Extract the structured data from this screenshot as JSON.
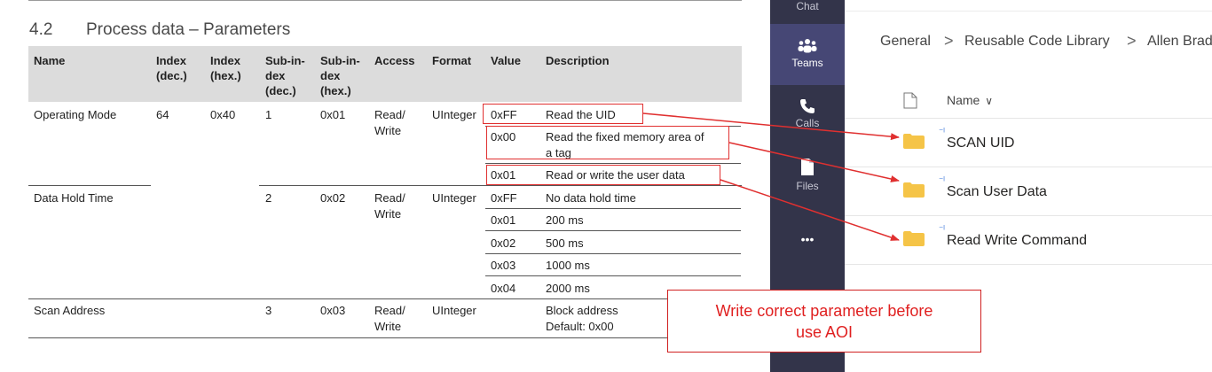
{
  "document": {
    "section_number": "4.2",
    "section_title": "Process data – Parameters",
    "columns": {
      "name": "Name",
      "index_dec": [
        "Index",
        "(dec.)"
      ],
      "index_hex": [
        "Index",
        "(hex.)"
      ],
      "subindex_dec": [
        "Sub-in-",
        "dex",
        "(dec.)"
      ],
      "subindex_hex": [
        "Sub-in-",
        "dex",
        "(hex.)"
      ],
      "access": "Access",
      "format": "Format",
      "value": "Value",
      "description": "Description"
    },
    "rows": [
      {
        "name": "Operating Mode",
        "index_dec": "64",
        "index_hex": "0x40",
        "subindex_dec": "1",
        "subindex_hex": "0x01",
        "access": [
          "Read/",
          "Write"
        ],
        "format": "UInteger",
        "values": [
          {
            "value": "0xFF",
            "description": [
              "Read the UID"
            ]
          },
          {
            "value": "0x00",
            "description": [
              "Read the fixed memory area of",
              "a tag"
            ]
          },
          {
            "value": "0x01",
            "description": [
              "Read or write the user data"
            ]
          }
        ]
      },
      {
        "name": "Data Hold Time",
        "index_dec": "",
        "index_hex": "",
        "subindex_dec": "2",
        "subindex_hex": "0x02",
        "access": [
          "Read/",
          "Write"
        ],
        "format": "UInteger",
        "values": [
          {
            "value": "0xFF",
            "description": [
              "No data hold time"
            ]
          },
          {
            "value": "0x01",
            "description": [
              "200 ms"
            ]
          },
          {
            "value": "0x02",
            "description": [
              "500 ms"
            ]
          },
          {
            "value": "0x03",
            "description": [
              "1000 ms"
            ]
          },
          {
            "value": "0x04",
            "description": [
              "2000 ms"
            ]
          }
        ]
      },
      {
        "name": "Scan Address",
        "index_dec": "",
        "index_hex": "",
        "subindex_dec": "3",
        "subindex_hex": "0x03",
        "access": [
          "Read/",
          "Write"
        ],
        "format": "UInteger",
        "values": [
          {
            "value": "",
            "description": [
              "Block address",
              "Default: 0x00"
            ]
          }
        ]
      }
    ]
  },
  "callout": {
    "line1": "Write correct parameter before",
    "line2": "use AOI"
  },
  "rail": {
    "chat": "Chat",
    "teams": "Teams",
    "calls": "Calls",
    "files": "Files",
    "more": "•••"
  },
  "files_panel": {
    "breadcrumb": [
      "General",
      "Reusable Code Library",
      "Allen Brad"
    ],
    "separator": ">",
    "column_name": "Name",
    "column_sort": "∨",
    "items": [
      {
        "name": "SCAN UID"
      },
      {
        "name": "Scan User Data"
      },
      {
        "name": "Read Write Command"
      }
    ],
    "sync_glyph": "⁻ˡ"
  },
  "colors": {
    "rail_bg": "#33344a",
    "rail_active": "#464775",
    "annotation_red": "#e03030",
    "folder_yellow": "#f5c447",
    "table_header_bg": "#dcdcdc"
  }
}
